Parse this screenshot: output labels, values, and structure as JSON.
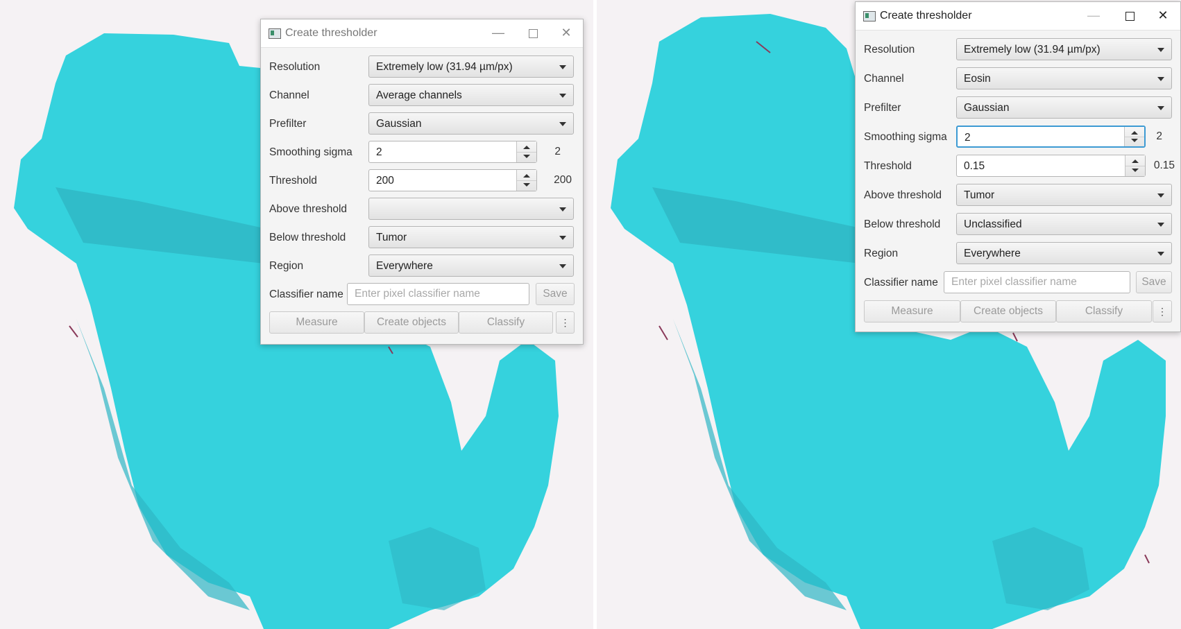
{
  "colors": {
    "overlay": "#35d2dd",
    "overlay_dark": "#2fb6c4",
    "background": "#f5f2f4",
    "focus": "#3c9ad3"
  },
  "dialogs": [
    {
      "title": "Create thresholder",
      "resolution": "Extremely low (31.94 µm/px)",
      "channel": "Average channels",
      "prefilter": "Gaussian",
      "smoothing_sigma": "2",
      "smoothing_sigma_echo": "2",
      "threshold": "200",
      "threshold_echo": "200",
      "above_threshold": "",
      "below_threshold": "Tumor",
      "region": "Everywhere"
    },
    {
      "title": "Create thresholder",
      "resolution": "Extremely low (31.94 µm/px)",
      "channel": "Eosin",
      "prefilter": "Gaussian",
      "smoothing_sigma": "2",
      "smoothing_sigma_echo": "2",
      "threshold": "0.15",
      "threshold_echo": "0.15",
      "above_threshold": "Tumor",
      "below_threshold": "Unclassified",
      "region": "Everywhere"
    }
  ],
  "labels": {
    "resolution": "Resolution",
    "channel": "Channel",
    "prefilter": "Prefilter",
    "smoothing_sigma": "Smoothing sigma",
    "threshold": "Threshold",
    "above_threshold": "Above threshold",
    "below_threshold": "Below threshold",
    "region": "Region",
    "classifier_name": "Classifier name"
  },
  "classifier_placeholder": "Enter pixel classifier name",
  "buttons": {
    "save": "Save",
    "measure": "Measure",
    "create_objects": "Create objects",
    "classify": "Classify",
    "more": "⋮"
  },
  "window_controls": {
    "minimize": "—",
    "close": "✕"
  }
}
